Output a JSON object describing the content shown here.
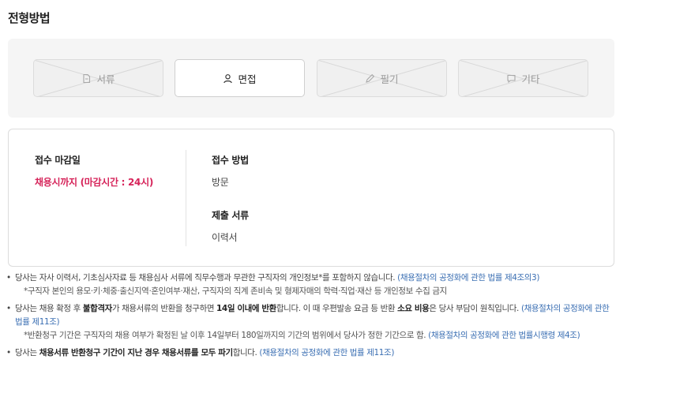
{
  "section_title": "전형방법",
  "methods": [
    {
      "label": "서류",
      "icon": "document-icon",
      "active": false
    },
    {
      "label": "면접",
      "icon": "person-icon",
      "active": true
    },
    {
      "label": "필기",
      "icon": "pencil-icon",
      "active": false
    },
    {
      "label": "기타",
      "icon": "chat-icon",
      "active": false
    }
  ],
  "info": {
    "deadline_label": "접수 마감일",
    "deadline_value": "채용시까지 (마감시간 : 24시)",
    "method_label": "접수 방법",
    "method_value": "방문",
    "docs_label": "제출 서류",
    "docs_value": "이력서"
  },
  "notes": {
    "n1_text": "당사는 자사 이력서, 기초심사자료 등 채용심사 서류에 직무수행과 무관한 구직자의 개인정보*를 포함하지 않습니다.",
    "n1_law": "(채용절차의 공정화에 관한 법률 제4조의3)",
    "n1_sub": "*구직자 본인의 용모·키·체중·출신지역·혼인여부·재산, 구직자의 직계 존비속 및 형제자매의 학력·직업·재산 등 개인정보 수집 금지",
    "n2_a": "당사는 채용 확정 후 ",
    "n2_b": "불합격자",
    "n2_c": "가 채용서류의 반환을 청구하면 ",
    "n2_d": "14일 이내에 반환",
    "n2_e": "합니다. 이 때 우편발송 요금 등 반환 ",
    "n2_f": "소요 비용",
    "n2_g": "은 당사 부담이 원칙입니다. ",
    "n2_law": "(채용절차의 공정화에 관한 법률 제11조)",
    "n2_sub": "*반환청구 기간은 구직자의 채용 여부가 확정된 날 이후 14일부터 180일까지의 기간의 범위에서 당사가 정한 기간으로 함. ",
    "n2_sub_law": "(채용절차의 공정화에 관한 법률시행령 제4조)",
    "n3_a": "당사는 ",
    "n3_b": "채용서류 반환청구 기간이 지난 경우 채용서류를 모두 파기",
    "n3_c": "합니다. ",
    "n3_law": "(채용절차의 공정화에 관한 법률 제11조)"
  }
}
